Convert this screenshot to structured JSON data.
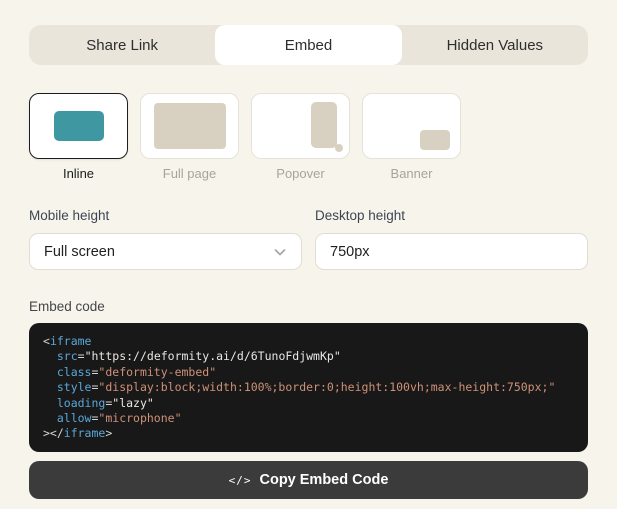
{
  "tabs": {
    "items": [
      {
        "label": "Share Link",
        "active": false
      },
      {
        "label": "Embed",
        "active": true
      },
      {
        "label": "Hidden Values",
        "active": false
      }
    ]
  },
  "embed_types": {
    "options": [
      {
        "label": "Inline",
        "selected": true
      },
      {
        "label": "Full page",
        "selected": false
      },
      {
        "label": "Popover",
        "selected": false
      },
      {
        "label": "Banner",
        "selected": false
      }
    ],
    "inline_shape_color": "#3e97a1",
    "placeholder_shape_color": "#d8d1c2"
  },
  "fields": {
    "mobile_height": {
      "label": "Mobile height",
      "value": "Full screen"
    },
    "desktop_height": {
      "label": "Desktop height",
      "value": "750px"
    }
  },
  "embed_code": {
    "label": "Embed code",
    "background": "#181818",
    "token_colors": {
      "punct": "#d4d4d4",
      "tag": "#5ba7d8",
      "attr": "#5ba7d8",
      "string_light": "#e9e7e4",
      "string_accent": "#ce9178"
    },
    "lines": [
      [
        {
          "text": "<",
          "type": "punct"
        },
        {
          "text": "iframe",
          "type": "tag"
        }
      ],
      [
        {
          "text": "  ",
          "type": "punct"
        },
        {
          "text": "src",
          "type": "attr"
        },
        {
          "text": "=",
          "type": "punct"
        },
        {
          "text": "\"https://deformity.ai/d/6TunoFdjwmKp\"",
          "type": "string_light"
        }
      ],
      [
        {
          "text": "  ",
          "type": "punct"
        },
        {
          "text": "class",
          "type": "attr"
        },
        {
          "text": "=",
          "type": "punct"
        },
        {
          "text": "\"deformity-embed\"",
          "type": "string_accent"
        }
      ],
      [
        {
          "text": "  ",
          "type": "punct"
        },
        {
          "text": "style",
          "type": "attr"
        },
        {
          "text": "=",
          "type": "punct"
        },
        {
          "text": "\"display:block;width:100%;border:0;height:100vh;max-height:750px;\"",
          "type": "string_accent"
        }
      ],
      [
        {
          "text": "  ",
          "type": "punct"
        },
        {
          "text": "loading",
          "type": "attr"
        },
        {
          "text": "=",
          "type": "punct"
        },
        {
          "text": "\"lazy\"",
          "type": "string_light"
        }
      ],
      [
        {
          "text": "  ",
          "type": "punct"
        },
        {
          "text": "allow",
          "type": "attr"
        },
        {
          "text": "=",
          "type": "punct"
        },
        {
          "text": "\"microphone\"",
          "type": "string_accent"
        }
      ],
      [
        {
          "text": "></",
          "type": "punct"
        },
        {
          "text": "iframe",
          "type": "tag"
        },
        {
          "text": ">",
          "type": "punct"
        }
      ]
    ]
  },
  "copy_button": {
    "label": "Copy Embed Code",
    "icon_glyph": "</>"
  },
  "colors": {
    "page_background": "#f7f4ec",
    "tabbar_background": "#eae5db",
    "button_background": "#3b3b3b"
  }
}
